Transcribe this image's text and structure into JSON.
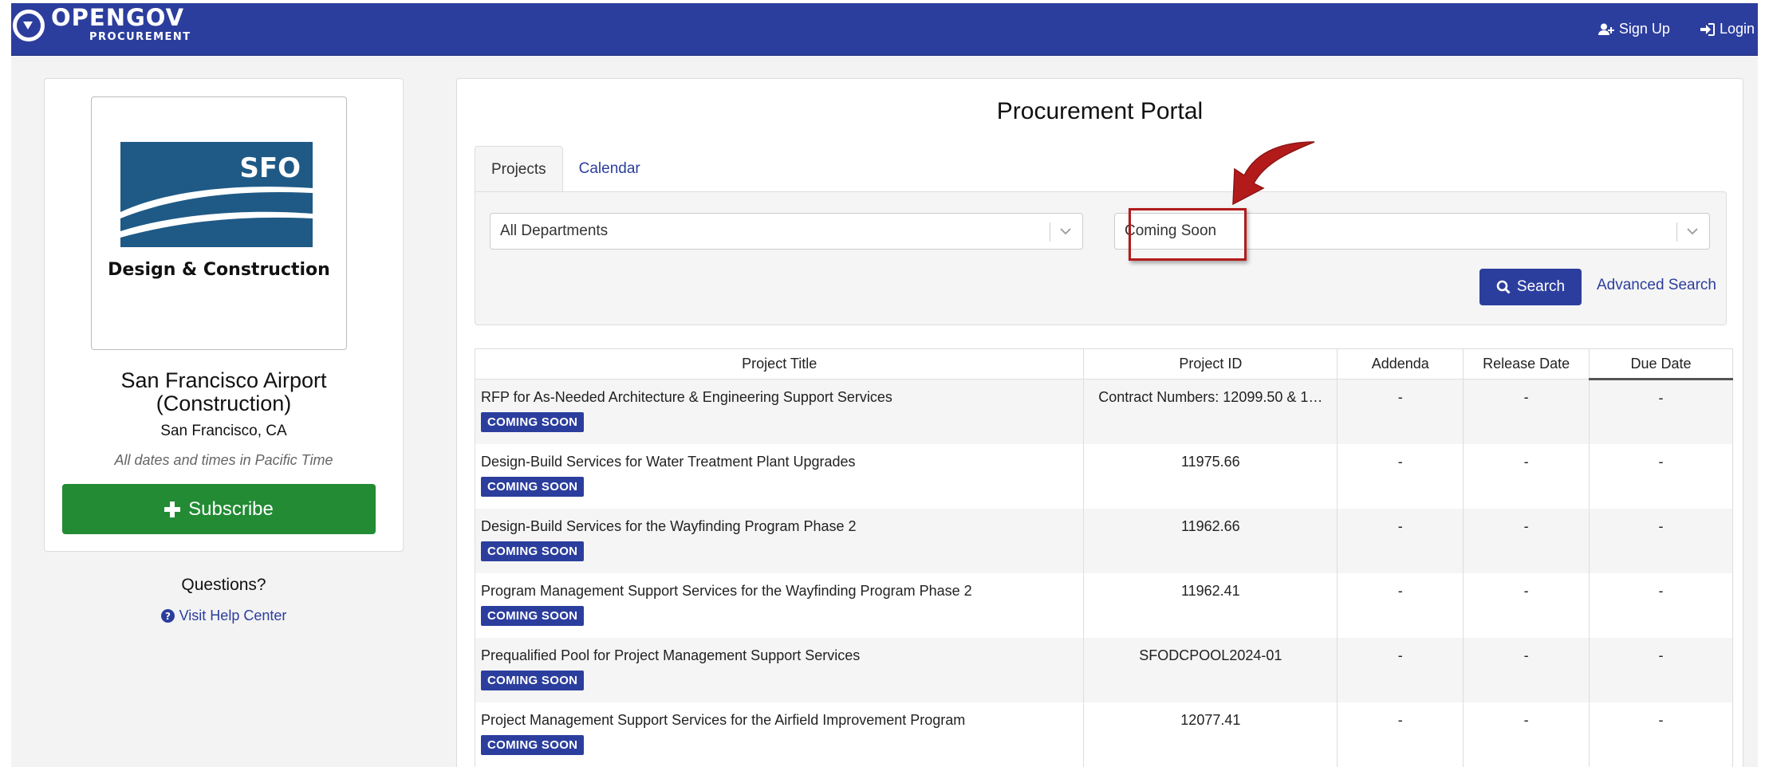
{
  "header": {
    "brand": "OPENGOV",
    "brand_sub": "PROCUREMENT",
    "signup_label": "Sign Up",
    "login_label": "Login"
  },
  "sidebar": {
    "logo_text": "SFO",
    "logo_subtitle": "Design & Construction",
    "org_name_line1": "San Francisco Airport",
    "org_name_line2": "(Construction)",
    "location": "San Francisco, CA",
    "timezone_note": "All dates and times in Pacific Time",
    "subscribe_label": "Subscribe",
    "questions_label": "Questions?",
    "help_label": "Visit Help Center"
  },
  "main": {
    "title": "Procurement Portal",
    "tabs": [
      {
        "label": "Projects"
      },
      {
        "label": "Calendar"
      }
    ],
    "filters": {
      "department": "All Departments",
      "status": "Coming Soon",
      "search_label": "Search",
      "advanced_label": "Advanced Search"
    },
    "table": {
      "columns": [
        "Project Title",
        "Project ID",
        "Addenda",
        "Release Date",
        "Due Date"
      ],
      "rows": [
        {
          "title": "RFP for As-Needed Architecture & Engineering Support Services",
          "badge": "COMING SOON",
          "id": "Contract Numbers: 12099.50 & 1…",
          "addenda": "-",
          "release": "-",
          "due": "-"
        },
        {
          "title": "Design-Build Services for Water Treatment Plant Upgrades",
          "badge": "COMING SOON",
          "id": "11975.66",
          "addenda": "-",
          "release": "-",
          "due": "-"
        },
        {
          "title": "Design-Build Services for the Wayfinding Program Phase 2",
          "badge": "COMING SOON",
          "id": "11962.66",
          "addenda": "-",
          "release": "-",
          "due": "-"
        },
        {
          "title": "Program Management Support Services for the Wayfinding Program Phase 2",
          "badge": "COMING SOON",
          "id": "11962.41",
          "addenda": "-",
          "release": "-",
          "due": "-"
        },
        {
          "title": "Prequalified Pool for Project Management Support Services",
          "badge": "COMING SOON",
          "id": "SFODCPOOL2024-01",
          "addenda": "-",
          "release": "-",
          "due": "-"
        },
        {
          "title": "Project Management Support Services for the Airfield Improvement Program",
          "badge": "COMING SOON",
          "id": "12077.41",
          "addenda": "-",
          "release": "-",
          "due": "-"
        }
      ]
    }
  },
  "colors": {
    "brand_blue": "#2c3e9d",
    "subscribe_green": "#228b34",
    "highlight_red": "#b31b1b",
    "sfo_blue": "#1f5a86"
  },
  "icons": {
    "signup": "user-plus-icon",
    "login": "sign-in-icon",
    "subscribe": "plus-icon",
    "help": "question-circle-icon",
    "search": "search-icon",
    "dropdown": "chevron-down-icon",
    "annotation": "curved-arrow-icon"
  }
}
